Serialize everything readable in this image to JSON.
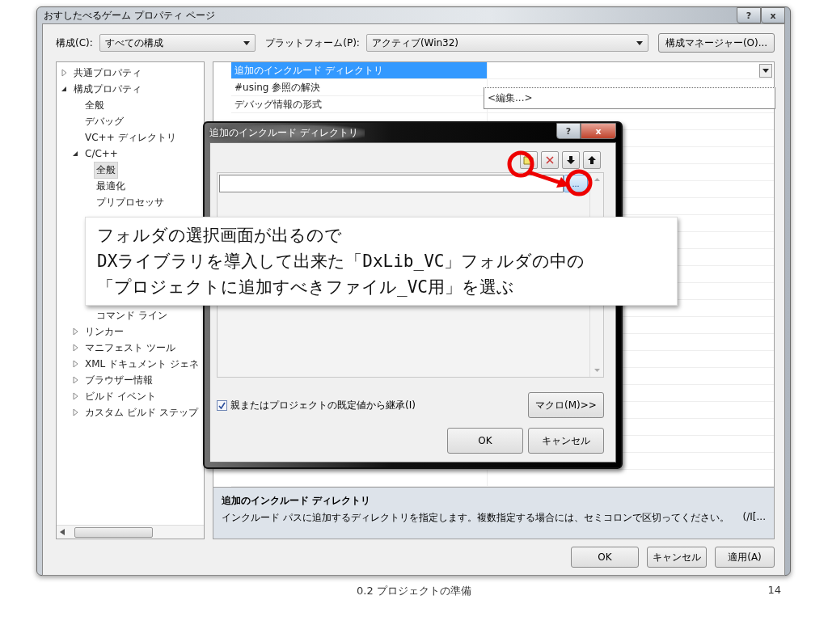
{
  "window": {
    "title": "おすしたべるゲーム プロパティ ページ",
    "help": "?",
    "close": "x"
  },
  "config": {
    "label": "構成(C):",
    "value": "すべての構成"
  },
  "platform": {
    "label": "プラットフォーム(P):",
    "value": "アクティブ(Win32)"
  },
  "config_manager": "構成マネージャー(O)...",
  "tree": [
    {
      "label": "共通プロパティ",
      "expanded": false,
      "selected": false
    },
    {
      "label": "構成プロパティ",
      "expanded": true,
      "selected": false,
      "children": [
        {
          "label": "全般",
          "selected": false
        },
        {
          "label": "デバッグ",
          "selected": false
        },
        {
          "label": "VC++ ディレクトリ",
          "selected": false
        },
        {
          "label": "C/C++",
          "expanded": true,
          "selected": false,
          "children": [
            {
              "label": "全般",
              "selected": true
            },
            {
              "label": "最適化",
              "selected": false
            },
            {
              "label": "プリプロセッサ",
              "selected": false
            },
            {
              "label": "コマンド ライン",
              "selected": false
            }
          ]
        },
        {
          "label": "リンカー",
          "expanded": false,
          "selected": false
        },
        {
          "label": "マニフェスト ツール",
          "expanded": false,
          "selected": false
        },
        {
          "label": "XML ドキュメント ジェネ",
          "expanded": false,
          "selected": false
        },
        {
          "label": "ブラウザー情報",
          "expanded": false,
          "selected": false
        },
        {
          "label": "ビルド イベント",
          "expanded": false,
          "selected": false
        },
        {
          "label": "カスタム ビルド ステップ",
          "expanded": false,
          "selected": false
        }
      ]
    }
  ],
  "properties": [
    {
      "name": "追加のインクルード ディレクトリ",
      "selected": true
    },
    {
      "name": "#using 参照の解決",
      "selected": false
    },
    {
      "name": "デバッグ情報の形式",
      "selected": false
    }
  ],
  "dropdown": {
    "options": [
      "<編集...>"
    ]
  },
  "dialog": {
    "title": "追加のインクルード ディレクトリ",
    "help": "?",
    "close": "x",
    "browse": "...",
    "checkbox": {
      "label": "親またはプロジェクトの既定値から継承(I)",
      "checked": true
    },
    "macro": "マクロ(M)>>",
    "ok": "OK",
    "cancel": "キャンセル"
  },
  "description": {
    "title": "追加のインクルード ディレクトリ",
    "text": "インクルード パスに追加するディレクトリを指定します。複数指定する場合には、セミコロンで区切ってください。",
    "switch": "(/I[..."
  },
  "buttons": [
    "OK",
    "キャンセル",
    "適用(A)"
  ],
  "callout": {
    "lines": [
      "フォルダの選択画面が出るので",
      "DXライブラリを導入して出来た「DxLib_VC」フォルダの中の",
      "「プロジェクトに追加すべきファイル_VC用」を選ぶ"
    ]
  },
  "footer": {
    "title": "0.2 プロジェクトの準備",
    "page": "14"
  }
}
